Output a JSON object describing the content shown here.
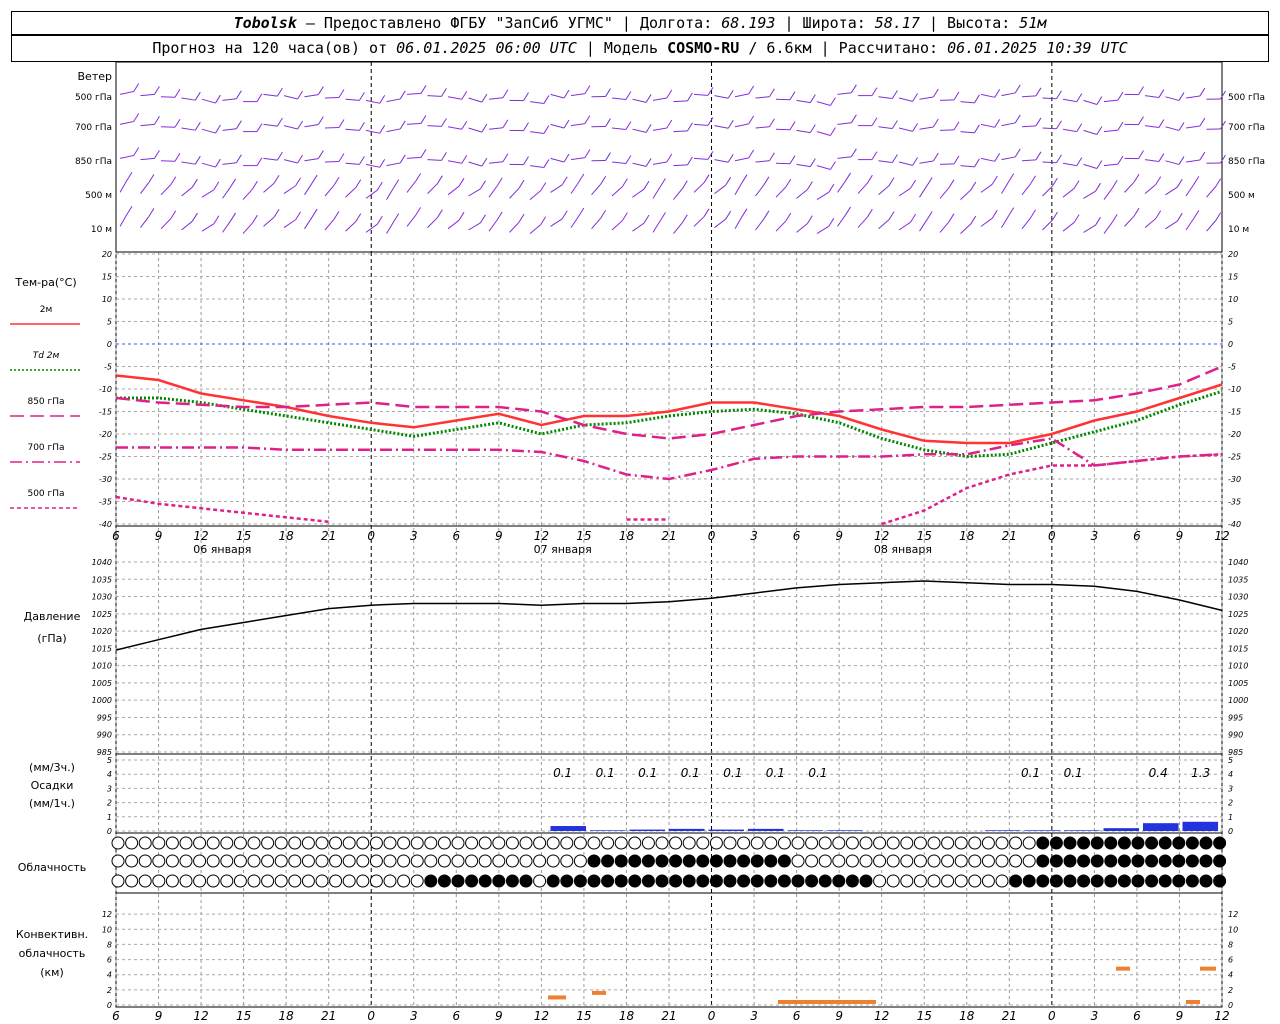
{
  "header": {
    "station": "Tobolsk",
    "provider": "— Предоставлено ФГБУ \"ЗапСиб УГМС\" |",
    "lon_label": "Долгота:",
    "lon": "68.193",
    "lat_label": "| Широта:",
    "lat": "58.17",
    "alt_label": "| Высота:",
    "alt": "51м",
    "fc_prefix": "Прогноз на 120 часа(ов) от",
    "fc_start": "06.01.2025 06:00 UTC",
    "model_label": "| Модель",
    "model": "COSMO-RU",
    "res": "/ 6.6км | Рассчитано:",
    "calc_time": "06.01.2025 10:39 UTC"
  },
  "chart_data": {
    "type": "meteogram",
    "hour_ticks": [
      "6",
      "9",
      "12",
      "15",
      "18",
      "21",
      "0",
      "3",
      "6",
      "9",
      "12",
      "15",
      "18",
      "21",
      "0",
      "3",
      "6",
      "9",
      "12",
      "15",
      "18",
      "21",
      "0",
      "3",
      "6",
      "9",
      "12"
    ],
    "day_labels": [
      "06 января",
      "07 января",
      "08 января"
    ],
    "wind": {
      "title": "Ветер",
      "levels": [
        "500 гПа",
        "700 гПа",
        "850 гПа",
        "500 м",
        "10 м"
      ],
      "colors": [
        "#8a2be2",
        "#7d2fd0"
      ]
    },
    "temperature": {
      "title": "Тем-ра(°C)",
      "ylim": [
        -40,
        20
      ],
      "yticks": [
        20,
        15,
        10,
        5,
        0,
        -5,
        -10,
        -15,
        -20,
        -25,
        -30,
        -35,
        -40
      ],
      "series": [
        {
          "name": "2м",
          "color": "#ff3333",
          "style": "solid",
          "values": [
            -7,
            -8,
            -11,
            -12.5,
            -14,
            -16,
            -17.5,
            -18.5,
            -17,
            -15.5,
            -18,
            -16,
            -16,
            -15,
            -13,
            -13,
            -14.5,
            -16,
            -19,
            -21.5,
            -22,
            -22,
            -20,
            -17,
            -15,
            -12,
            -9
          ]
        },
        {
          "name": "Td 2м",
          "color": "#008800",
          "style": "dot",
          "values": [
            -12,
            -12,
            -13,
            -14.5,
            -16,
            -17.5,
            -19,
            -20.5,
            -19,
            -17.5,
            -20,
            -18,
            -17.5,
            -16,
            -15,
            -14.5,
            -15.5,
            -17.5,
            -21,
            -23.5,
            -25,
            -24.5,
            -22,
            -19.5,
            -17,
            -13.5,
            -10.5
          ]
        },
        {
          "name": "850 гПа",
          "color": "#e0208a",
          "style": "longdash",
          "values": [
            -12,
            -13,
            -13.5,
            -14,
            -14,
            -13.5,
            -13,
            -14,
            -14,
            -14,
            -15,
            -18,
            -20,
            -21,
            -20,
            -18,
            -16,
            -15,
            -14.5,
            -14,
            -14,
            -13.5,
            -13,
            -12.5,
            -11,
            -9,
            -5
          ]
        },
        {
          "name": "700 гПа",
          "color": "#e0208a",
          "style": "dashdot",
          "values": [
            -23,
            -23,
            -23,
            -23,
            -23.5,
            -23.5,
            -23.5,
            -23.5,
            -23.5,
            -23.5,
            -24,
            -26,
            -29,
            -30,
            -28,
            -25.5,
            -25,
            -25,
            -25,
            -24.5,
            -24.5,
            -22.5,
            -21,
            -27,
            -26,
            -25,
            -24.5
          ]
        },
        {
          "name": "500 гПа",
          "color": "#e0208a",
          "style": "shortdash",
          "values": [
            -34,
            -35.5,
            -36.5,
            -37.5,
            -38.5,
            -39.5,
            null,
            null,
            null,
            null,
            null,
            null,
            -39,
            -39,
            null,
            null,
            null,
            null,
            -40,
            -37,
            -32,
            -29,
            -27,
            -27,
            -26,
            -25,
            -24.5
          ]
        }
      ]
    },
    "pressure": {
      "title": "Давление",
      "unit": "(гПа)",
      "ylim": [
        985,
        1040
      ],
      "yticks": [
        1040,
        1035,
        1030,
        1025,
        1020,
        1015,
        1010,
        1005,
        1000,
        995,
        990,
        985
      ],
      "values": [
        1014.5,
        1017.5,
        1020.5,
        1022.5,
        1024.5,
        1026.5,
        1027.5,
        1028,
        1028,
        1028,
        1027.5,
        1028,
        1028,
        1028.5,
        1029.5,
        1031,
        1032.5,
        1033.5,
        1034,
        1034.5,
        1034,
        1033.5,
        1033.5,
        1033,
        1031.5,
        1029,
        1026
      ],
      "color": "#000000"
    },
    "precip": {
      "title": "Осадки",
      "unit3": "(мм/3ч.)",
      "unit1": "(мм/1ч.)",
      "ylim": [
        0,
        5
      ],
      "yticks": [
        "5",
        "4",
        "3",
        "2",
        "1",
        "0"
      ],
      "labels": [
        "0.1",
        "0.1",
        "0.1",
        "0.1",
        "0.1",
        "0.1",
        "0.1",
        "0.1",
        "0.1",
        "0.4",
        "1.3"
      ],
      "bars_mm1h": [
        0,
        0,
        0,
        0,
        0,
        0,
        0,
        0,
        0,
        0,
        0,
        0.35,
        0.05,
        0.1,
        0.15,
        0.1,
        0.15,
        0.05,
        0.05,
        0,
        0,
        0,
        0.05,
        0.05,
        0.05,
        0.2,
        0.55,
        0.65
      ],
      "color": "#2233dd"
    },
    "cloud": {
      "title": "Облачность",
      "rows": 3
    },
    "convective": {
      "title": "Конвективн. облачность (км)",
      "ylim": [
        0,
        14
      ],
      "yticks": [
        "12",
        "10",
        "8",
        "6",
        "4",
        "2",
        "0"
      ],
      "color": "#f08030"
    }
  }
}
